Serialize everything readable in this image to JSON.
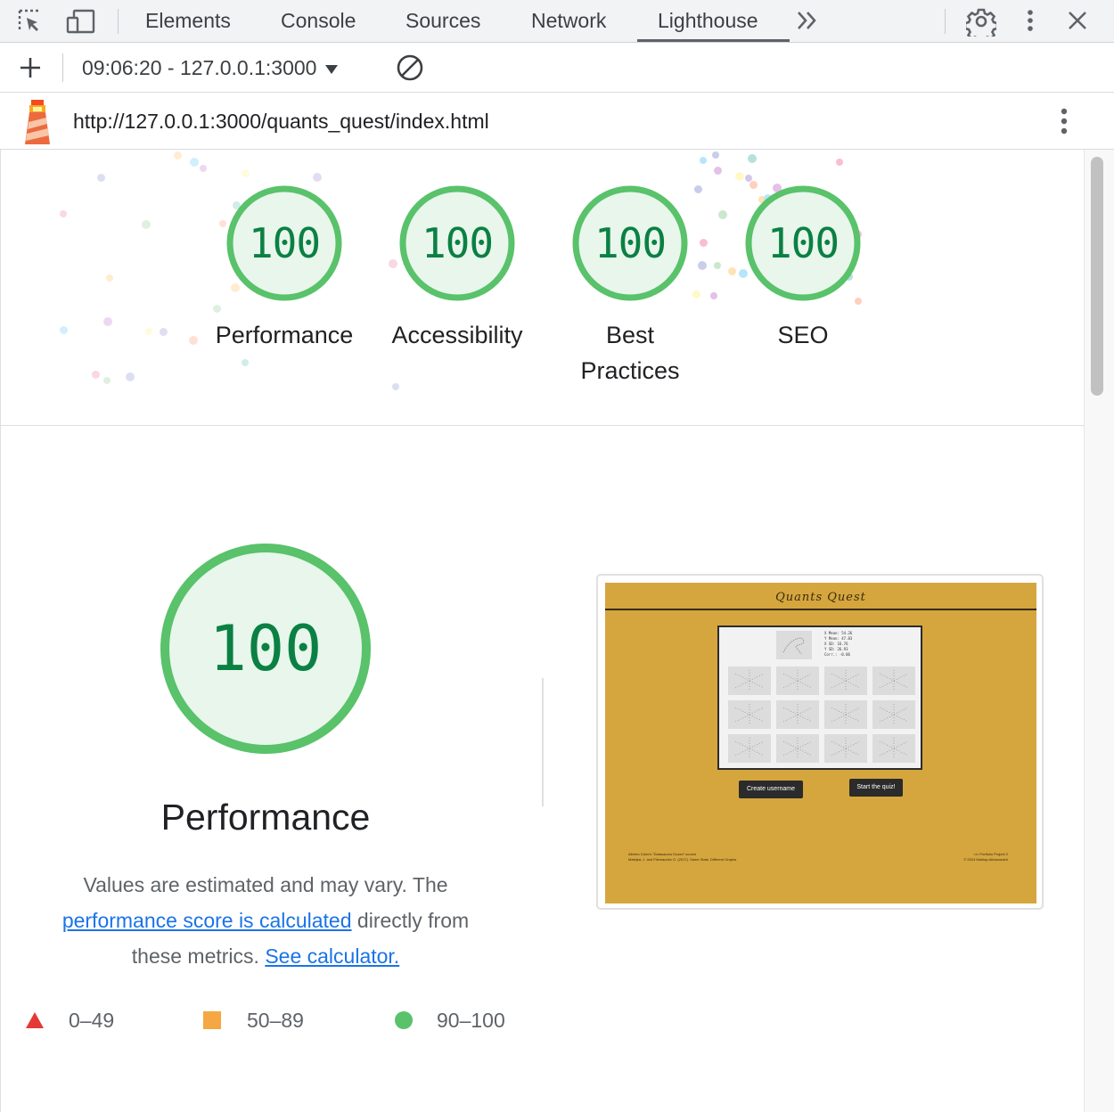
{
  "devtools": {
    "tabs": [
      {
        "label": "Elements",
        "active": false
      },
      {
        "label": "Console",
        "active": false
      },
      {
        "label": "Sources",
        "active": false
      },
      {
        "label": "Network",
        "active": false
      },
      {
        "label": "Lighthouse",
        "active": true
      }
    ]
  },
  "toolbar": {
    "report_selector": "09:06:20 - 127.0.0.1:3000"
  },
  "urlbar": {
    "url": "http://127.0.0.1:3000/quants_quest/index.html"
  },
  "scores": [
    {
      "score": "100",
      "label": "Performance"
    },
    {
      "score": "100",
      "label": "Accessibility"
    },
    {
      "score": "100",
      "label_line1": "Best",
      "label_line2": "Practices"
    },
    {
      "score": "100",
      "label": "SEO"
    }
  ],
  "performance": {
    "score": "100",
    "title": "Performance",
    "desc_part1": "Values are estimated and may vary. The",
    "desc_link1": "performance score is calculated",
    "desc_part2": "directly from",
    "desc_part3": "these metrics.",
    "desc_link2": "See calculator."
  },
  "legend": [
    {
      "range": "0–49",
      "color": "#e53935",
      "shape": "triangle"
    },
    {
      "range": "50–89",
      "color": "#f4a742",
      "shape": "square"
    },
    {
      "range": "90–100",
      "color": "#59c26a",
      "shape": "circle"
    }
  ],
  "screenshot": {
    "title": "Quants Quest",
    "stats": [
      "X Mean: 54.26",
      "Y Mean: 47.83",
      "X SD: 16.76",
      "Y SD: 26.93",
      "Corr.: -0.06"
    ],
    "button_create": "Create username",
    "button_start": "Start the quiz!",
    "footer_left_1": "Alberto Cairo's \"Datasaurus Dozen\" source",
    "footer_left_2": "Matejka, J. and Fitzmaurice G. (2017). Same Stats, Different Graphs",
    "footer_right_1": "</> Portfolio Project 2",
    "footer_right_2": "© 2024 Mahtap Akbarzadeh"
  },
  "colors": {
    "pass_green": "#59c26a",
    "pass_fill": "#e8f6ec",
    "score_text": "#0b8043",
    "screenshot_bg": "#d5a63e"
  }
}
